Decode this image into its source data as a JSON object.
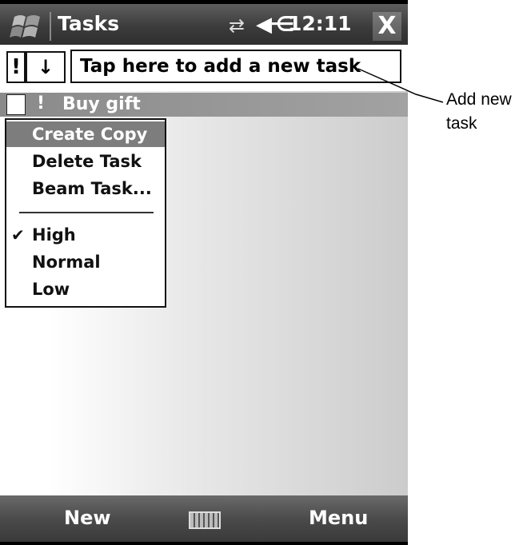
{
  "titlebar": {
    "app_title": "Tasks",
    "time": "12:11",
    "close_label": "X",
    "sync_glyph": "⇄",
    "volume_glyph": "◀⋲",
    "icons": [
      "windows-start-icon",
      "sync-icon",
      "volume-icon",
      "close-icon"
    ]
  },
  "toolbar": {
    "priority_label": "!",
    "sort_label": "↓",
    "new_task_placeholder": "Tap here to add a new task"
  },
  "task": {
    "priority_glyph": "!",
    "name": "Buy gift",
    "checked": false
  },
  "context_menu": {
    "items": [
      {
        "label": "Create Copy",
        "selected": true
      },
      {
        "label": "Delete Task",
        "selected": false
      },
      {
        "label": "Beam Task...",
        "selected": false
      }
    ],
    "priority_items": [
      {
        "label": "High",
        "checked": true
      },
      {
        "label": "Normal",
        "checked": false
      },
      {
        "label": "Low",
        "checked": false
      }
    ],
    "check_glyph": "✔"
  },
  "bottombar": {
    "left_label": "New",
    "right_label": "Menu",
    "keyboard_icon": "keyboard-icon"
  },
  "callout": {
    "text": "Add new task"
  },
  "colors": {
    "bar_dark": "#3c3c3c",
    "selection": "#7d7d7d",
    "task_row": "#8a8a8a"
  }
}
